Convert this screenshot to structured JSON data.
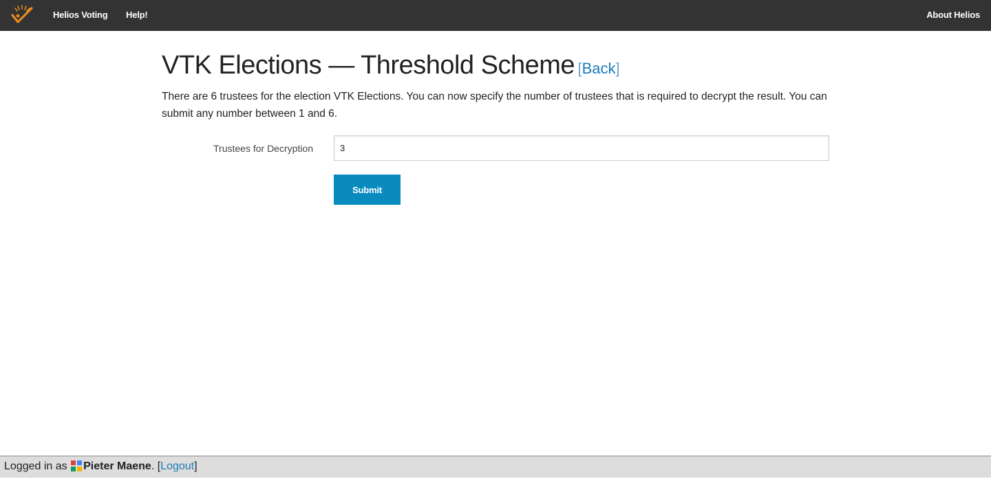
{
  "topbar": {
    "home_label": "Helios Voting",
    "help_label": "Help!",
    "about_label": "About Helios",
    "logo_icon": "helios-checkmark-logo-icon",
    "accent_color": "#e8891d",
    "background_color": "#333333"
  },
  "page": {
    "title": "VTK Elections — Threshold Scheme",
    "back_open": "[",
    "back_label": "Back",
    "back_close": "]",
    "description": "There are 6 trustees for the election VTK Elections. You can now specify the number of trustees that is required to decrypt the result. You can submit any number between 1 and 6."
  },
  "form": {
    "trustees_label": "Trustees for Decryption",
    "trustees_value": "3",
    "submit_label": "Submit",
    "submit_color": "#0a8bc0"
  },
  "footer": {
    "logged_in_prefix": "Logged in as",
    "user_icon": "google-account-icon",
    "username": "Pieter Maene",
    "after_name": ".",
    "logout_open": "[",
    "logout_label": "Logout",
    "logout_close": "]"
  }
}
